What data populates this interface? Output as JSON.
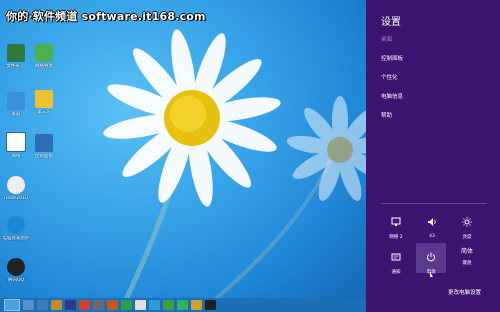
{
  "watermark": "你的·软件频道 software.it168.com",
  "desktop_icons": [
    {
      "label": "文件夹 ..."
    },
    {
      "label": "网络共享"
    },
    {
      "label": "家庭"
    },
    {
      "label": "第三方"
    },
    {
      "label": "网络"
    },
    {
      "label": "控制面板"
    },
    {
      "label": "电脑管家"
    },
    {
      "label": "回收站"
    },
    {
      "label": "iTools2010"
    },
    {
      "label": "电脑管家防护"
    },
    {
      "label": "腾讯QQ"
    }
  ],
  "charms": {
    "title": "设置",
    "section": "桌面",
    "items": [
      "控制面板",
      "个性化",
      "电脑信息",
      "帮助"
    ],
    "tiles": [
      {
        "icon": "network-icon",
        "label": "网络 2"
      },
      {
        "icon": "volume-icon",
        "label": "43"
      },
      {
        "icon": "brightness-icon",
        "label": "亮度"
      },
      {
        "icon": "notifications-icon",
        "label": "通知"
      },
      {
        "icon": "power-icon",
        "label": "电源"
      },
      {
        "icon": "keyboard-icon",
        "label": "键盘",
        "label_top": "简体"
      }
    ],
    "change_pc_settings": "更改电脑设置"
  },
  "colors": {
    "charms_bg": "#3d1470",
    "desktop_blue": "#39a6ea",
    "taskbar": "#1a6fb8"
  }
}
